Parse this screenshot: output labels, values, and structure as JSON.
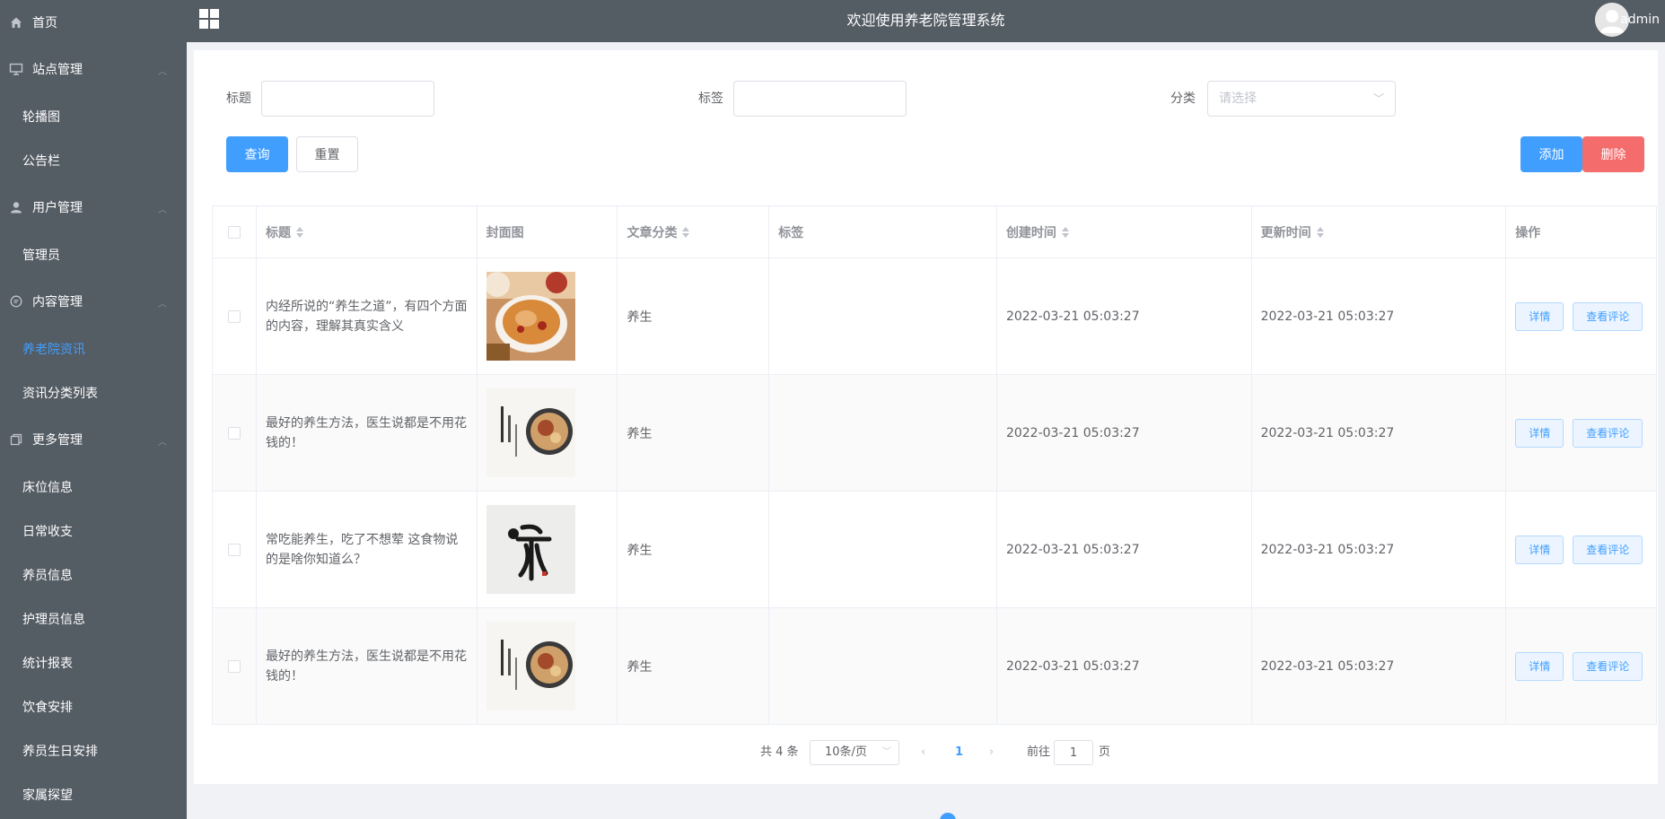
{
  "header": {
    "title": "欢迎使用养老院管理系统",
    "username": "admin"
  },
  "sidebar": {
    "home": "首页",
    "groups": [
      {
        "label": "站点管理",
        "items": [
          "轮播图",
          "公告栏"
        ]
      },
      {
        "label": "用户管理",
        "items": [
          "管理员"
        ]
      },
      {
        "label": "内容管理",
        "items": [
          "养老院资讯",
          "资讯分类列表"
        ]
      },
      {
        "label": "更多管理",
        "items": [
          "床位信息",
          "日常收支",
          "养员信息",
          "护理员信息",
          "统计报表",
          "饮食安排",
          "养员生日安排",
          "家属探望"
        ]
      }
    ],
    "active": "养老院资讯"
  },
  "filters": {
    "title_label": "标题",
    "title_value": "",
    "tag_label": "标签",
    "tag_value": "",
    "category_label": "分类",
    "category_placeholder": "请选择"
  },
  "buttons": {
    "search": "查询",
    "reset": "重置",
    "add": "添加",
    "delete": "删除"
  },
  "table": {
    "headers": [
      "标题",
      "封面图",
      "文章分类",
      "标签",
      "创建时间",
      "更新时间",
      "操作"
    ],
    "rows": [
      {
        "title": "内经所说的“养生之道”，有四个方面的内容，理解其真实含义",
        "category": "养生",
        "tag": "",
        "created": "2022-03-21 05:03:27",
        "updated": "2022-03-21 05:03:27"
      },
      {
        "title": "最好的养生方法，医生说都是不用花钱的！",
        "category": "养生",
        "tag": "",
        "created": "2022-03-21 05:03:27",
        "updated": "2022-03-21 05:03:27"
      },
      {
        "title": "常吃能养生，吃了不想荤 这食物说的是啥你知道么？",
        "category": "养生",
        "tag": "",
        "created": "2022-03-21 05:03:27",
        "updated": "2022-03-21 05:03:27"
      },
      {
        "title": "最好的养生方法，医生说都是不用花钱的！",
        "category": "养生",
        "tag": "",
        "created": "2022-03-21 05:03:27",
        "updated": "2022-03-21 05:03:27"
      }
    ],
    "detail_label": "详情",
    "comments_label": "查看评论"
  },
  "pagination": {
    "total": "共 4 条",
    "page_size": "10条/页",
    "current_page": "1",
    "goto_label": "前往",
    "goto_value": "1",
    "page_suffix": "页"
  }
}
